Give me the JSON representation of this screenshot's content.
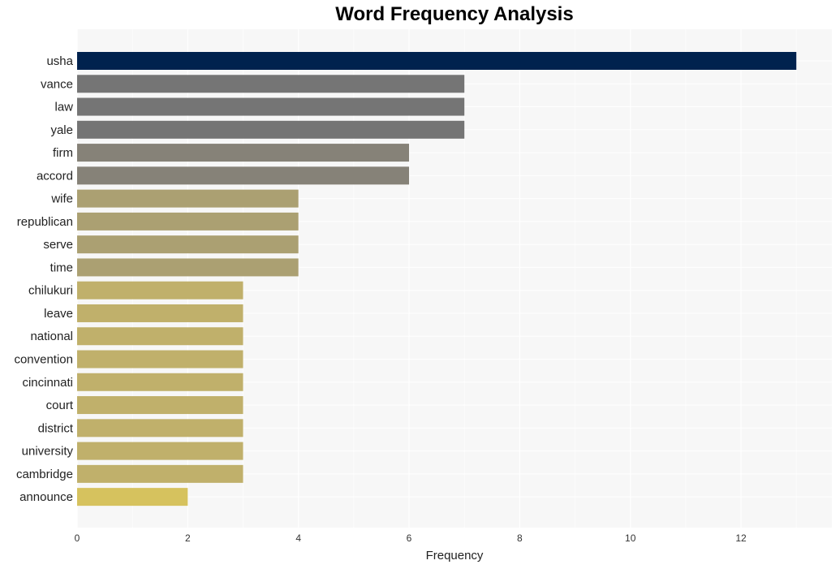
{
  "chart_data": {
    "type": "bar",
    "orientation": "horizontal",
    "title": "Word Frequency Analysis",
    "xlabel": "Frequency",
    "ylabel": "",
    "xlim": [
      0,
      13.6
    ],
    "xticks": [
      0,
      2,
      4,
      6,
      8,
      10,
      12
    ],
    "grid": true,
    "legend": "none",
    "categories": [
      "usha",
      "vance",
      "law",
      "yale",
      "firm",
      "accord",
      "wife",
      "republican",
      "serve",
      "time",
      "chilukuri",
      "leave",
      "national",
      "convention",
      "cincinnati",
      "court",
      "district",
      "university",
      "cambridge",
      "announce"
    ],
    "values": [
      13,
      7,
      7,
      7,
      6,
      6,
      4,
      4,
      4,
      4,
      3,
      3,
      3,
      3,
      3,
      3,
      3,
      3,
      3,
      2
    ],
    "colors": [
      "#00224e",
      "#757575",
      "#757575",
      "#757575",
      "#868278",
      "#868278",
      "#aba072",
      "#aba072",
      "#aba072",
      "#aba072",
      "#c0b06b",
      "#c0b06b",
      "#c0b06b",
      "#c0b06b",
      "#c0b06b",
      "#c0b06b",
      "#c0b06b",
      "#c0b06b",
      "#c0b06b",
      "#d6c25e"
    ]
  }
}
